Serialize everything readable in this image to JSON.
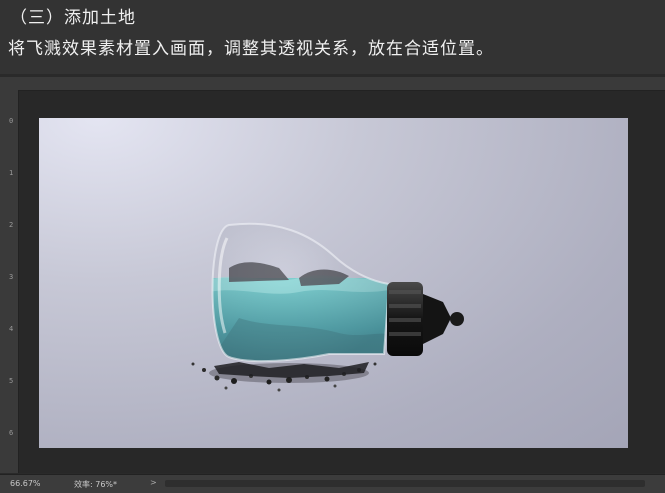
{
  "tutorial": {
    "heading": "（三）添加土地",
    "instruction": "将飞溅效果素材置入画面，调整其透视关系，放在合适位置。"
  },
  "ruler": {
    "vertical_ticks": [
      "0",
      "1",
      "2",
      "3",
      "4",
      "5",
      "6"
    ]
  },
  "status_bar": {
    "zoom": "66.67%",
    "info": "效率: 76%*",
    "arrow": ">"
  },
  "canvas": {
    "background_color": "#b4b5c6",
    "subject": "light-bulb-with-water-and-soil"
  },
  "colors": {
    "app_background": "#333333",
    "water": "#2e9a9e",
    "bulb_base": "#1c1c1c"
  }
}
